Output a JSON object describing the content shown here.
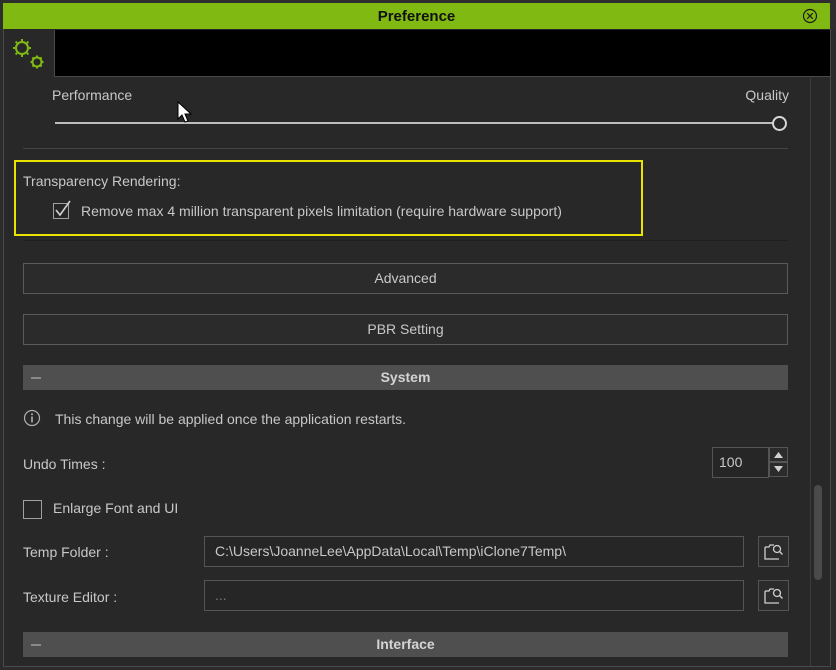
{
  "window": {
    "title": "Preference",
    "close_icon": "circle-x-icon",
    "accent_color": "#80b911",
    "highlight_color": "#e8e400"
  },
  "sidebar": {
    "active_tab_icon": "gears-icon"
  },
  "render_quality": {
    "left_label": "Performance",
    "right_label": "Quality",
    "slider_value_fraction": 1.0
  },
  "transparency": {
    "heading": "Transparency Rendering:",
    "checkbox_label": "Remove max 4 million transparent pixels limitation (require hardware support)",
    "checked": true
  },
  "buttons": {
    "advanced": "Advanced",
    "pbr_setting": "PBR Setting"
  },
  "system": {
    "section_title": "System",
    "collapse_icon": "minus-icon",
    "info_text": "This change will be applied once the application restarts.",
    "undo_label": "Undo Times :",
    "undo_value": "100",
    "enlarge_label": "Enlarge Font and UI",
    "enlarge_checked": false,
    "temp_folder_label": "Temp Folder :",
    "temp_folder_value": "C:\\Users\\JoanneLee\\AppData\\Local\\Temp\\iClone7Temp\\",
    "texture_editor_label": "Texture Editor :",
    "texture_editor_value": "..."
  },
  "interface": {
    "section_title": "Interface"
  }
}
